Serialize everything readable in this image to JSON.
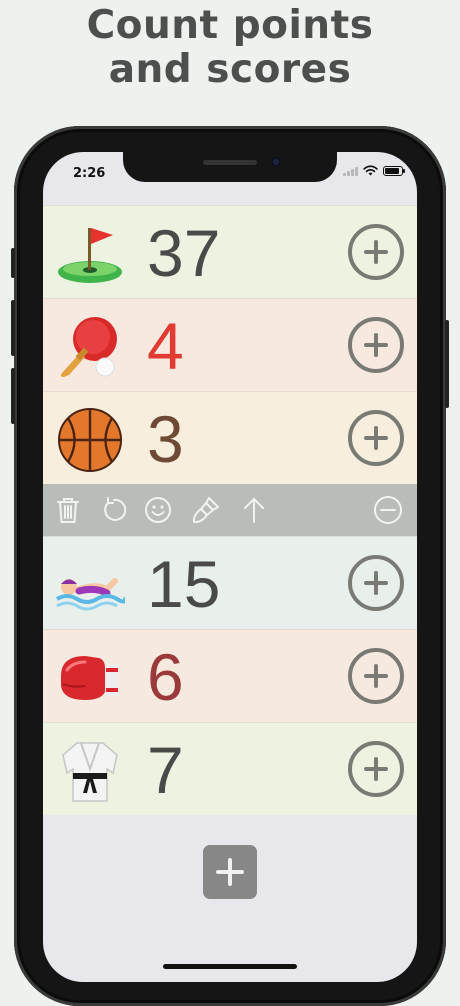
{
  "headline": {
    "line1": "Count points",
    "line2": "and scores"
  },
  "status_bar": {
    "time": "2:26",
    "icons": [
      "cellular-signal-icon",
      "wifi-icon",
      "battery-icon"
    ]
  },
  "counters": [
    {
      "icon": "golf-flag-icon",
      "score": "37",
      "color": "#4a4a4a",
      "background": "#eef3e1"
    },
    {
      "icon": "ping-pong-icon",
      "score": "4",
      "color": "#e03a33",
      "background": "#f7e9df"
    },
    {
      "icon": "basketball-icon",
      "score": "3",
      "color": "#6e4a35",
      "background": "#f8eedd"
    },
    {
      "icon": "swimmer-icon",
      "score": "15",
      "color": "#4a4a4a",
      "background": "#e9f0ec"
    },
    {
      "icon": "boxing-glove-icon",
      "score": "6",
      "color": "#9a3a3a",
      "background": "#f6e9e0"
    },
    {
      "icon": "martial-arts-uniform-icon",
      "score": "7",
      "color": "#4a4a4a",
      "background": "#eef3e1"
    }
  ],
  "toolbar": {
    "after_row": 2,
    "tools": [
      "trash-icon",
      "undo-icon",
      "smiley-icon",
      "paint-brush-icon",
      "move-up-icon",
      "minus-circle-icon"
    ]
  },
  "add_button": {
    "icon": "plus-icon"
  },
  "colors": {
    "background": "#eef2ee",
    "headline": "#4b4f4e",
    "toolbar": "#b8bdb9",
    "plus_ring": "#7a7a74",
    "add_button": "#878787"
  }
}
